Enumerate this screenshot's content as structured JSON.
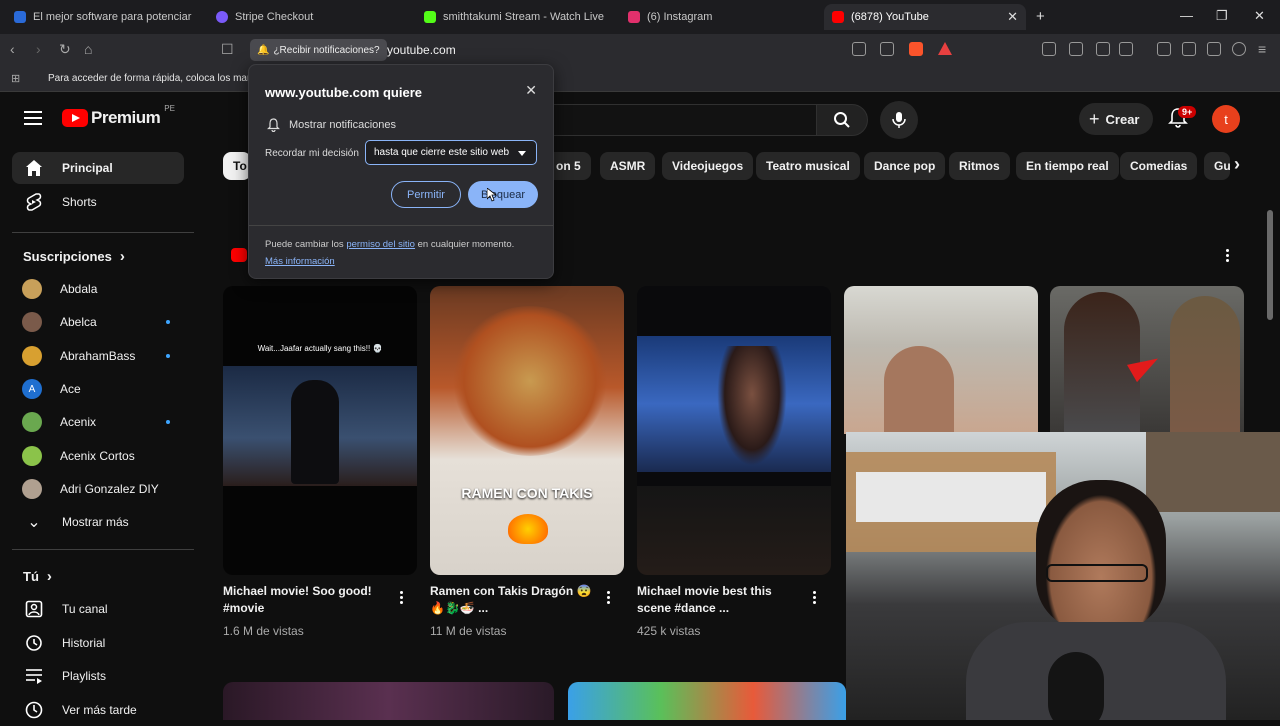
{
  "browser": {
    "tabs": [
      {
        "title": "El mejor software para potenciar tu e",
        "color": "#2a6ad8"
      },
      {
        "title": "Stripe Checkout",
        "color": "#7a5af8"
      },
      {
        "title": "smithtakumi Stream - Watch Live on",
        "color": "#53fc18"
      },
      {
        "title": "(6) Instagram",
        "color": "#e1306c"
      },
      {
        "title": "(6878) YouTube",
        "color": "#ff0000",
        "active": true
      }
    ],
    "new_tab": "+",
    "notification_chip": "¿Recibir notificaciones?",
    "url": "youtube.com",
    "bookmarks_hint": "Para acceder de forma rápida, coloca los marc"
  },
  "permission_popup": {
    "title": "www.youtube.com quiere",
    "close": "✕",
    "permission": "Mostrar notificaciones",
    "remember_label": "Recordar mi decisión",
    "remember_value": "hasta que cierre este sitio web",
    "allow": "Permitir",
    "block": "Bloquear",
    "footer_prefix": "Puede cambiar los ",
    "footer_link": "permiso del sitio",
    "footer_suffix": " en cualquier momento.",
    "more_info": "Más información"
  },
  "youtube": {
    "logo_text": "Premium",
    "country": "PE",
    "create": "Crear",
    "notif_count": "9+",
    "avatar_letter": "t",
    "chips": [
      "To",
      "on 5",
      "ASMR",
      "Videojuegos",
      "Teatro musical",
      "Dance pop",
      "Ritmos",
      "En tiempo real",
      "Comedias",
      "Gu"
    ],
    "sidebar": {
      "main": [
        {
          "label": "Principal",
          "icon": "home-icon",
          "active": true
        },
        {
          "label": "Shorts",
          "icon": "shorts-icon"
        }
      ],
      "subs_title": "Suscripciones",
      "subs": [
        {
          "label": "Abdala",
          "color": "#c8a05a",
          "dot": false
        },
        {
          "label": "Abelca",
          "color": "#7a5a4a",
          "dot": true
        },
        {
          "label": "AbrahamBass",
          "color": "#d8a030",
          "dot": true
        },
        {
          "label": "Ace",
          "color": "#1f6fd0",
          "dot": false
        },
        {
          "label": "Acenix",
          "color": "#6aa84f",
          "dot": true
        },
        {
          "label": "Acenix Cortos",
          "color": "#8bc34a",
          "dot": false
        },
        {
          "label": "Adri Gonzalez DIY",
          "color": "#b0a090",
          "dot": false
        }
      ],
      "show_more": "Mostrar más",
      "you_title": "Tú",
      "you": [
        {
          "label": "Tu canal",
          "icon": "channel-icon"
        },
        {
          "label": "Historial",
          "icon": "history-icon"
        },
        {
          "label": "Playlists",
          "icon": "playlists-icon"
        },
        {
          "label": "Ver más tarde",
          "icon": "watch-later-icon"
        }
      ]
    },
    "shorts": [
      {
        "title": "Michael movie! Soo good! #movie",
        "views": "1.6 M de vistas",
        "caption": "Wait...Jaafar actually sang this!! 💀"
      },
      {
        "title": "Ramen con Takis Dragón 😨🔥🐉🍜 ...",
        "views": "11 M de vistas",
        "caption": "RAMEN CON TAKIS"
      },
      {
        "title": "Michael movie best  this scene #dance ...",
        "views": "425 k vistas",
        "caption": ""
      }
    ]
  }
}
